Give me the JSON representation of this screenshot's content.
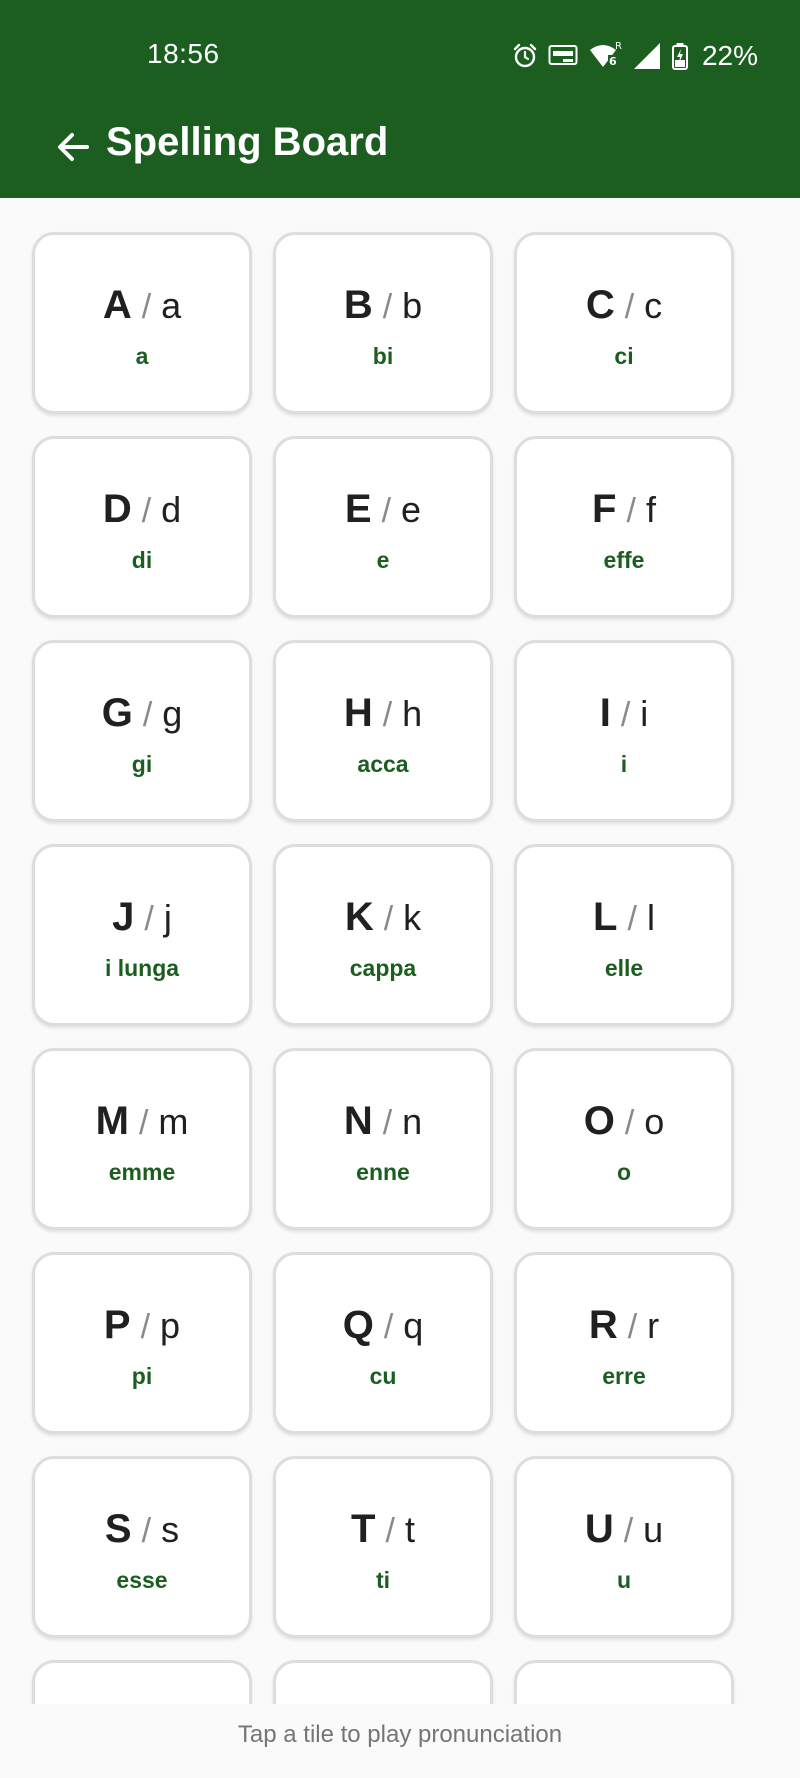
{
  "status_bar": {
    "time": "18:56",
    "battery": "22%",
    "icons": [
      "alarm-icon",
      "auto-hz-icon",
      "wifi-6-icon",
      "signal-icon",
      "battery-charging-icon"
    ],
    "roaming": "R"
  },
  "appbar": {
    "title": "Spelling Board",
    "back_icon": "arrow-left-icon"
  },
  "colors": {
    "primary": "#1b5e20",
    "on_primary": "#ffffff",
    "tile_border": "#dddddd",
    "background": "#fafafa"
  },
  "tiles": [
    {
      "upper": "A",
      "lower": "a",
      "pron": "a"
    },
    {
      "upper": "B",
      "lower": "b",
      "pron": "bi"
    },
    {
      "upper": "C",
      "lower": "c",
      "pron": "ci"
    },
    {
      "upper": "D",
      "lower": "d",
      "pron": "di"
    },
    {
      "upper": "E",
      "lower": "e",
      "pron": "e"
    },
    {
      "upper": "F",
      "lower": "f",
      "pron": "effe"
    },
    {
      "upper": "G",
      "lower": "g",
      "pron": "gi"
    },
    {
      "upper": "H",
      "lower": "h",
      "pron": "acca"
    },
    {
      "upper": "I",
      "lower": "i",
      "pron": "i"
    },
    {
      "upper": "J",
      "lower": "j",
      "pron": "i lunga"
    },
    {
      "upper": "K",
      "lower": "k",
      "pron": "cappa"
    },
    {
      "upper": "L",
      "lower": "l",
      "pron": "elle"
    },
    {
      "upper": "M",
      "lower": "m",
      "pron": "emme"
    },
    {
      "upper": "N",
      "lower": "n",
      "pron": "enne"
    },
    {
      "upper": "O",
      "lower": "o",
      "pron": "o"
    },
    {
      "upper": "P",
      "lower": "p",
      "pron": "pi"
    },
    {
      "upper": "Q",
      "lower": "q",
      "pron": "cu"
    },
    {
      "upper": "R",
      "lower": "r",
      "pron": "erre"
    },
    {
      "upper": "S",
      "lower": "s",
      "pron": "esse"
    },
    {
      "upper": "T",
      "lower": "t",
      "pron": "ti"
    },
    {
      "upper": "U",
      "lower": "u",
      "pron": "u"
    },
    {
      "upper": "",
      "lower": "",
      "pron": ""
    },
    {
      "upper": "",
      "lower": "",
      "pron": ""
    },
    {
      "upper": "",
      "lower": "",
      "pron": ""
    }
  ],
  "separator": "/",
  "footer": {
    "hint": "Tap a tile to play pronunciation"
  }
}
